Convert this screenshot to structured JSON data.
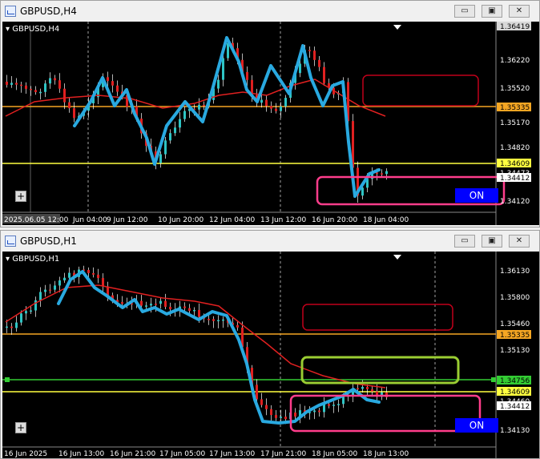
{
  "window_top": {
    "title": "GBPUSD,H4",
    "symbol_label": "GBPUSD,H4",
    "on_label": "ON",
    "plus_label": "+",
    "ctrl_min": "▭",
    "ctrl_max": "▣",
    "ctrl_close": "✕",
    "price_ticks": [
      "1.36220",
      "1.35520",
      "1.35170",
      "1.34820",
      "1.34120"
    ],
    "price_labels": [
      {
        "text": "1.36419",
        "kind": "current"
      },
      {
        "text": "1.35335",
        "kind": "orange"
      },
      {
        "text": "1.34609",
        "kind": "yellow"
      },
      {
        "text": "1.34412",
        "kind": "white"
      },
      {
        "text": "1.34473",
        "kind": "white"
      }
    ],
    "time_labels": [
      "2025.06.05 12:00",
      "Jun 04:00",
      "9 Jun 12:00",
      "10 Jun 20:00",
      "12 Jun 04:00",
      "13 Jun 12:00",
      "16 Jun 20:00",
      "18 Jun 04:00"
    ]
  },
  "window_bottom": {
    "title": "GBPUSD,H1",
    "symbol_label": "GBPUSD,H1",
    "on_label": "ON",
    "plus_label": "+",
    "ctrl_min": "▭",
    "ctrl_max": "▣",
    "ctrl_close": "✕",
    "price_ticks": [
      "1.36130",
      "1.35800",
      "1.35460",
      "1.35130",
      "1.34130"
    ],
    "price_labels": [
      {
        "text": "1.35335",
        "kind": "orange"
      },
      {
        "text": "1.34756",
        "kind": "green"
      },
      {
        "text": "1.34609",
        "kind": "yellow"
      },
      {
        "text": "1.34412",
        "kind": "white"
      },
      {
        "text": "1.34460",
        "kind": "white"
      }
    ],
    "time_labels": [
      "16 Jun 2025",
      "16 Jun 13:00",
      "16 Jun 21:00",
      "17 Jun 05:00",
      "17 Jun 13:00",
      "17 Jun 21:00",
      "18 Jun 05:00",
      "18 Jun 13:00"
    ]
  },
  "colors": {
    "background": "#000000",
    "bull_candle": "#2ec4c4",
    "bear_candle": "#e02020",
    "ma_line": "#e02020",
    "trend_line": "#29a9e0",
    "orange_level": "#f5a623",
    "yellow_level": "#ffff40",
    "green_level": "#33cc33",
    "box_red": "#c0001a",
    "box_pink": "#ff3d8b",
    "box_green": "#9acd32",
    "on_button": "#0000ff"
  }
}
